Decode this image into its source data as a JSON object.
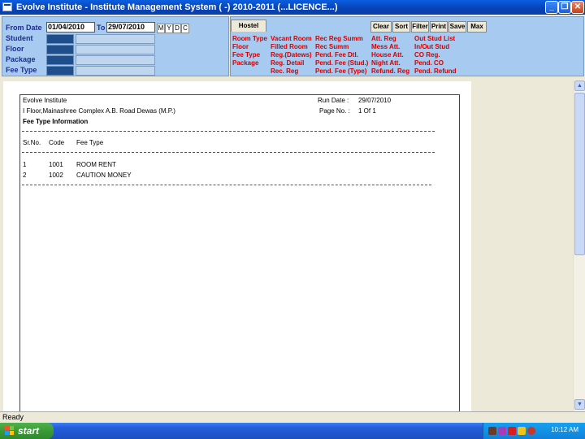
{
  "window": {
    "title": "Evolve Institute - Institute Management System ( -) 2010-2011 (...LICENCE...)"
  },
  "filters": {
    "from_date_label": "From Date",
    "from_date_value": "01/04/2010",
    "to_label": "To",
    "to_date_value": "29/07/2010",
    "mode_buttons": [
      "M",
      "Y",
      "D",
      "C"
    ],
    "fields": [
      "Student",
      "Floor",
      "Package",
      "Fee Type"
    ]
  },
  "hostel": {
    "tab_label": "Hostel",
    "actions": [
      "Clear",
      "Sort",
      "Filter",
      "Print",
      "Save",
      "Max"
    ],
    "links_col1": [
      "Room Type",
      "Floor",
      "Fee Type",
      "Package"
    ],
    "links_col2": [
      "Vacant Room",
      "Filled Room",
      "Reg.(Datews)",
      "Reg. Detail",
      "Rec. Reg"
    ],
    "links_col3": [
      "Rec Reg Summ",
      "Rec Summ",
      "Pend. Fee Dtl.",
      "Pend. Fee (Stud.)",
      "Pend. Fee (Type)"
    ],
    "links_col4": [
      "Att. Reg",
      "Mess Att.",
      "House Att.",
      "Night Att.",
      "Refund. Reg"
    ],
    "links_col5": [
      "Out Stud List",
      "In/Out Stud",
      "CO Reg.",
      "Pend. CO",
      "Pend. Refund"
    ]
  },
  "report": {
    "institute": "Evolve Institute",
    "address": "I Floor,Mainashree Complex A.B. Road Dewas (M.P.)",
    "run_date_label": "Run Date :",
    "run_date": "29/07/2010",
    "page_label": "Page No. :",
    "page_value": "1 Of 1",
    "heading": "Fee Type Information",
    "columns": [
      "Sr.No.",
      "Code",
      "Fee Type"
    ],
    "rows": [
      {
        "sr": "1",
        "code": "1001",
        "fee_type": "ROOM RENT"
      },
      {
        "sr": "2",
        "code": "1002",
        "fee_type": "CAUTION MONEY"
      }
    ]
  },
  "status": {
    "text": "Ready"
  },
  "taskbar": {
    "start_label": "start",
    "clock": "10:12 AM"
  },
  "colors": {
    "panel": "#A6CAF0",
    "link_red": "#D40000",
    "label_navy": "#1F2E8C",
    "title_blue": "#0842B5"
  }
}
